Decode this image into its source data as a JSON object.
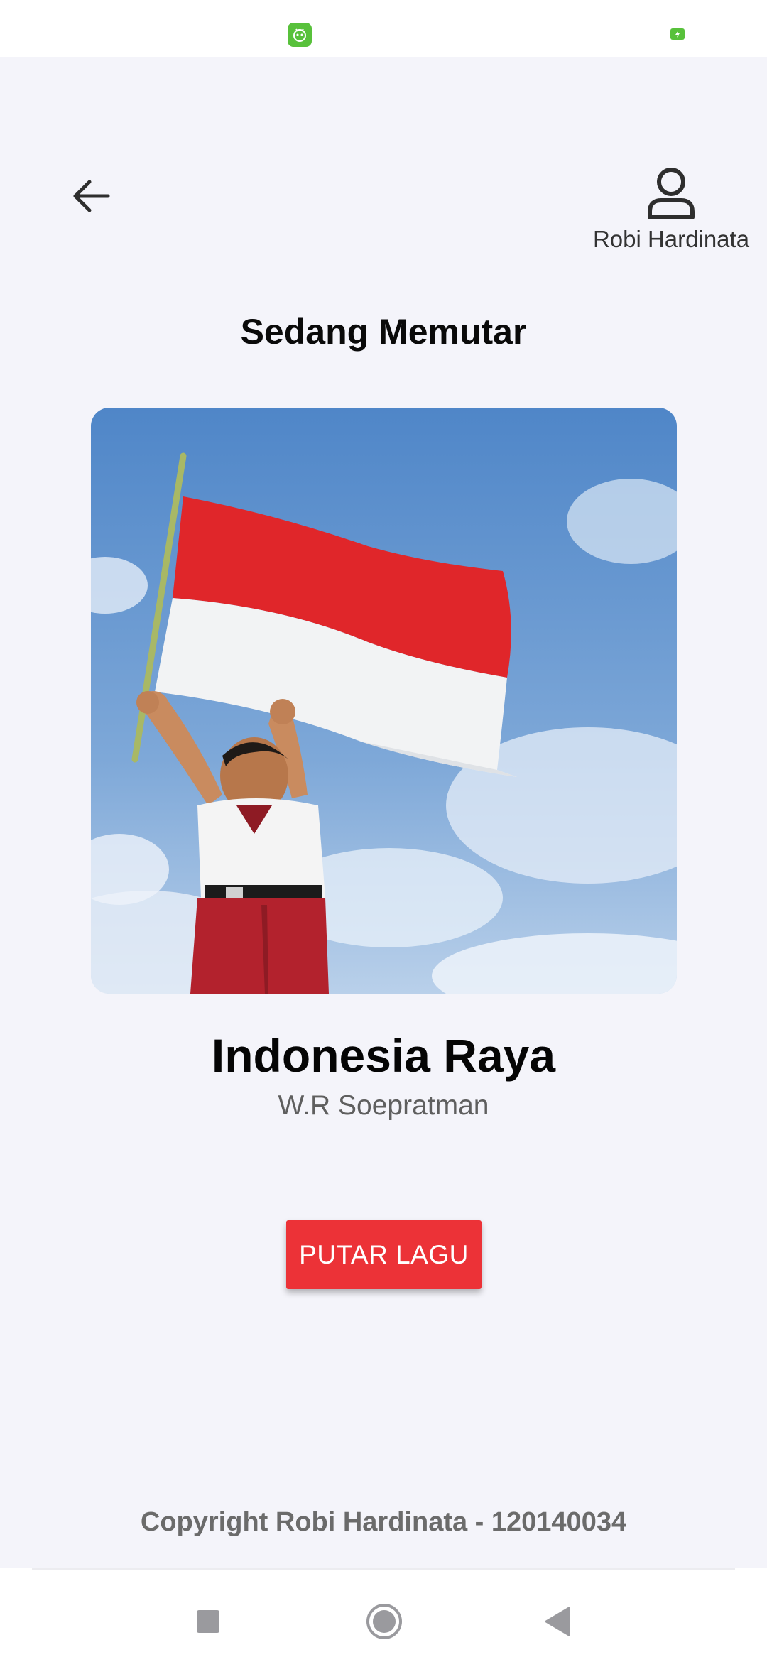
{
  "status_bar": {
    "app_icon": "android-robot-icon",
    "battery_icon": "battery-charging-icon",
    "accent": "#58c13b"
  },
  "header": {
    "back_icon": "arrow-left-icon",
    "profile_icon": "user-outline-icon",
    "profile_name": "Robi Hardinata"
  },
  "page": {
    "title": "Sedang Memutar",
    "background": "#f4f4fa"
  },
  "now_playing": {
    "cover_art": "indonesian-flag-photo",
    "song_title": "Indonesia Raya",
    "artist": "W.R Soepratman"
  },
  "actions": {
    "play_label": "PUTAR LAGU",
    "play_color": "#ec3237"
  },
  "footer": {
    "copyright": "Copyright Robi Hardinata - 120140034"
  },
  "nav_bar": {
    "recents_icon": "square-icon",
    "home_icon": "circle-home-icon",
    "back_icon": "triangle-back-icon"
  }
}
